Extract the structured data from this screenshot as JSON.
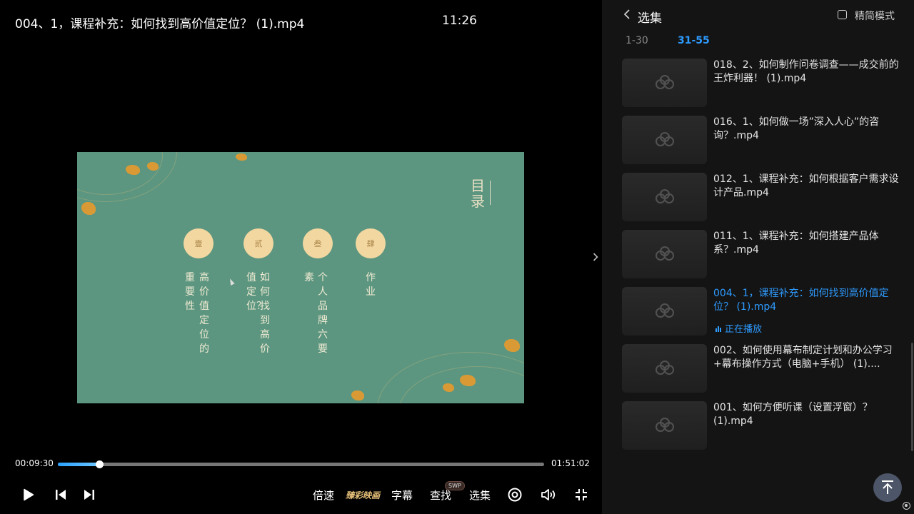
{
  "player": {
    "title": "004、1，课程补充：如何找到高价值定位？ (1).mp4",
    "clock": "11:26",
    "time_current": "00:09:30",
    "time_total": "01:51:02",
    "progress_fraction": 0.0854,
    "slide": {
      "heading": "目录",
      "items": [
        {
          "numeral": "壹",
          "lines": [
            "高价值定位的",
            "重要性"
          ]
        },
        {
          "numeral": "贰",
          "lines": [
            "如何找到高价",
            "值定位？"
          ]
        },
        {
          "numeral": "叁",
          "lines": [
            "个人品牌六要",
            "素"
          ]
        },
        {
          "numeral": "肆",
          "lines": [
            "作业"
          ]
        }
      ]
    },
    "controls": {
      "play_icon": "play-icon",
      "prev_icon": "skip-previous-icon",
      "next_icon": "skip-next-icon",
      "speed_label": "倍速",
      "enhance_label": "臻彩映画",
      "subtitle_label": "字幕",
      "search_label": "查找",
      "search_badge": "SWP",
      "episodes_label": "选集",
      "circle_icon": "record-icon",
      "volume_icon": "volume-icon",
      "fullscreen_icon": "exit-fullscreen-icon"
    }
  },
  "sidebar": {
    "title": "选集",
    "simple_mode_label": "精简模式",
    "tabs": [
      "1-30",
      "31-55"
    ],
    "active_tab": "31-55",
    "playing_label": "正在播放",
    "episodes": [
      {
        "title": "018、2、如何制作问卷调查——成交前的王炸利器！ (1).mp4",
        "active": false
      },
      {
        "title": "016、1、如何做一场”深入人心”的咨询？.mp4",
        "active": false
      },
      {
        "title": "012、1、课程补充：如何根据客户需求设计产品.mp4",
        "active": false
      },
      {
        "title": "011、1、课程补充：如何搭建产品体系？.mp4",
        "active": false
      },
      {
        "title": "004、1，课程补充：如何找到高价值定位？ (1).mp4",
        "active": true
      },
      {
        "title": "002、如何使用幕布制定计划和办公学习+幕布操作方式（电脑+手机） (1)....",
        "active": false
      },
      {
        "title": "001、如何方便听课（设置浮窗）？(1).mp4",
        "active": false
      }
    ]
  },
  "colors": {
    "accent": "#2e9bff",
    "slide_bg": "#5c9680",
    "slide_circle": "#f3d7a0",
    "enhance_gold": "#e8c27a"
  }
}
